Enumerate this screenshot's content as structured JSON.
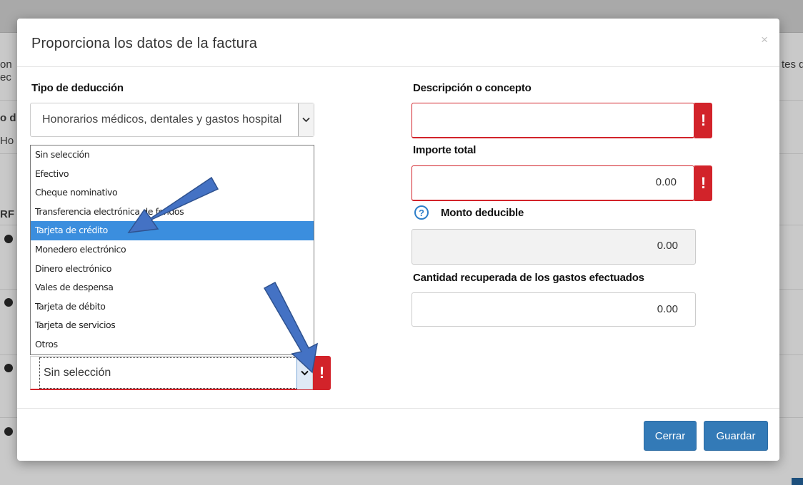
{
  "background": {
    "fragments": [
      "on",
      "ec",
      "o d",
      "Ho",
      "RF",
      "tes d",
      "es d"
    ]
  },
  "modal": {
    "title": "Proporciona los datos de la factura",
    "close_glyph": "×"
  },
  "left": {
    "tipo_label": "Tipo de deducción",
    "tipo_value": "Honorarios médicos, dentales y gastos hospital",
    "payment_options": [
      "Sin selección",
      "Efectivo",
      "Cheque nominativo",
      "Transferencia electrónica de fondos",
      "Tarjeta de crédito",
      "Monedero electrónico",
      "Dinero electrónico",
      "Vales de despensa",
      "Tarjeta de débito",
      "Tarjeta de servicios",
      "Otros"
    ],
    "selected_option_index": 4,
    "payment_value": "Sin selección",
    "error_glyph": "!"
  },
  "right": {
    "descripcion_label": "Descripción o concepto",
    "descripcion_value": "",
    "importe_label": "Importe total",
    "importe_value": "0.00",
    "monto_label": "Monto deducible",
    "monto_value": "0.00",
    "cantidad_label": "Cantidad recuperada de los gastos efectuados",
    "cantidad_value": "0.00",
    "help_glyph": "?",
    "error_glyph": "!"
  },
  "footer": {
    "cerrar_label": "Cerrar",
    "guardar_label": "Guardar"
  },
  "colors": {
    "primary": "#337ab7",
    "error": "#d2232a",
    "selected": "#3b8ede",
    "annotation_arrow": "#4472c4"
  },
  "icons": [
    "close-icon",
    "chevron-down-icon",
    "exclamation-icon",
    "question-circle-icon",
    "arrow-annotation"
  ]
}
